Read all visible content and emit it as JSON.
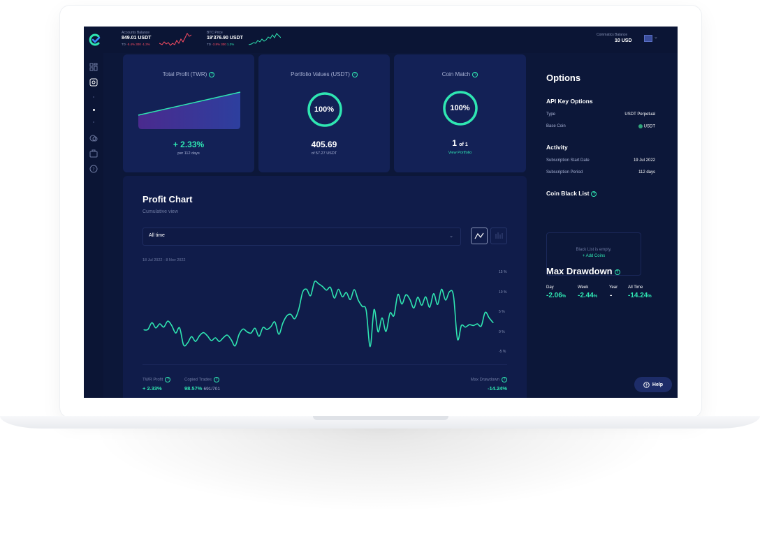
{
  "topbar": {
    "accounts_balance_label": "Accounts Balance",
    "accounts_balance_value": "849.01 USDT",
    "accounts_balance_change_prefix": "TD",
    "accounts_balance_change_1": "-5.4% 300",
    "accounts_balance_change_2": "-1.3%",
    "btc_price_label": "BTC Price",
    "btc_price_value": "19'376.90 USDT",
    "btc_change_prefix": "TD",
    "btc_change_1": "-3.8% 300",
    "btc_change_2": "1.3%",
    "coinmatics_balance_label": "Coinmatics Balance",
    "coinmatics_balance_value": "10 USD"
  },
  "cards": {
    "total_profit": {
      "title": "Total Profit (TWR)",
      "value": "+ 2.33%",
      "sub": "per 112 days"
    },
    "portfolio_values": {
      "title": "Portfolio Values (USDT)",
      "percent": "100%",
      "value": "405.69",
      "sub": "of 57.27 USDT"
    },
    "coin_match": {
      "title": "Coin Match",
      "percent": "100%",
      "value": "1",
      "of": "of 1",
      "link": "View Portfolio"
    }
  },
  "profit_chart": {
    "title": "Profit Chart",
    "subtitle": "Cumulative view",
    "range_select": "All time",
    "date_range": "18 Jul 2022 - 8 Nov 2022",
    "footer": {
      "twr_label": "TWR Profit",
      "twr_value": "+ 2.33%",
      "copied_label": "Copied Trades",
      "copied_value": "98.57%",
      "copied_count": "691/701",
      "drawdown_label": "Max Drawdown",
      "drawdown_value": "-14.24%"
    }
  },
  "chart_data": {
    "type": "line",
    "title": "",
    "xlabel": "",
    "ylabel": "",
    "y_ticks": [
      "15 %",
      "10 %",
      "5 %",
      "0 %",
      "-5 %"
    ],
    "ylim": [
      -5,
      15
    ],
    "series": [
      {
        "values": [
          0.5,
          0.6,
          2.3,
          1.0,
          2.0,
          1.2,
          2.7,
          1.6,
          -0.3,
          1.0,
          -3.3,
          -2.8,
          -1.2,
          -2.4,
          -1.0,
          -0.2,
          -1.0,
          -2.2,
          -1.5,
          -2.4,
          -1.5,
          -0.8,
          -2.0,
          -3.5,
          -0.6,
          0.7,
          0.0,
          -0.3,
          0.9,
          -1.1,
          1.1,
          0.6,
          1.3,
          2.5,
          -0.6,
          2.2,
          4.0,
          4.4,
          3.3,
          5.6,
          10.0,
          10.7,
          9.1,
          12.6,
          12.1,
          11.4,
          10.5,
          11.2,
          8.5,
          10.7,
          8.8,
          9.9,
          8.1,
          10.6,
          8.0,
          6.4,
          5.4,
          -3.7,
          5.6,
          0.0,
          3.5,
          0.1,
          4.7,
          4.1,
          9.4,
          7.0,
          9.3,
          8.2,
          6.0,
          8.7,
          6.7,
          8.8,
          6.2,
          9.6,
          6.9,
          10.7,
          8.0,
          10.1,
          9.1,
          -1.8,
          1.6,
          1.2,
          1.8,
          1.6,
          2.0,
          1.5,
          4.9,
          3.5,
          2.3
        ]
      }
    ],
    "grid": false,
    "line_color": "#2fe6b2"
  },
  "options": {
    "title": "Options",
    "api_key_title": "API Key Options",
    "type_label": "Type",
    "type_value": "USDT Perpetual",
    "base_coin_label": "Base Coin",
    "base_coin_value": "USDT",
    "activity_title": "Activity",
    "start_label": "Subscription Start Date",
    "start_value": "19 Jul 2022",
    "period_label": "Subscription Period",
    "period_value": "112 days",
    "blacklist_title": "Coin Black List",
    "blacklist_empty": "Black List is empty.",
    "blacklist_add": "+ Add Coins"
  },
  "max_drawdown": {
    "title": "Max Drawdown",
    "day_label": "Day",
    "day_value": "-2.06",
    "week_label": "Week",
    "week_value": "-2.44",
    "year_label": "Year",
    "year_value": "-",
    "all_label": "All Time",
    "all_value": "-14.24",
    "unit": "%"
  },
  "help": {
    "label": "Help"
  },
  "colors": {
    "accent": "#2fe6b2",
    "negative": "#ff4d63",
    "background": "#0c1739",
    "card": "#132156"
  }
}
